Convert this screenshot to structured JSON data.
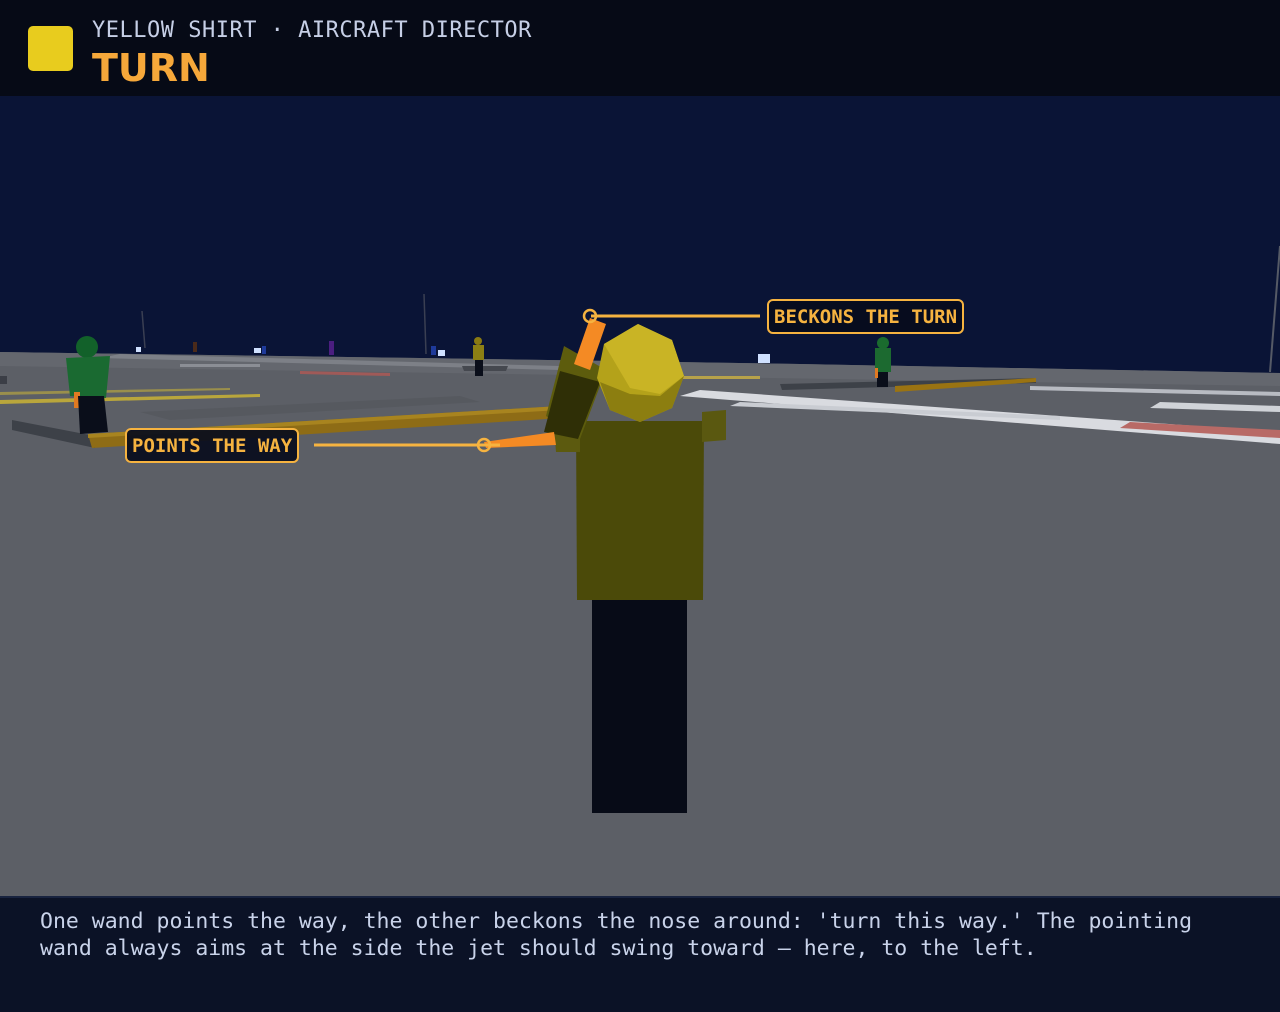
{
  "header": {
    "role_line": "YELLOW SHIRT · AIRCRAFT DIRECTOR",
    "signal_name": "TURN",
    "badge_color": "#e8cc1e",
    "icon": "yellow-shirt-color-swatch"
  },
  "callouts": {
    "beckons": "BECKONS THE TURN",
    "points": "POINTS THE WAY",
    "accent_color": "#f6b340"
  },
  "caption": {
    "text": "One wand points the way, the other beckons the nose around: 'turn this way.' The pointing wand always aims at the side the jet should swing toward — here, to the left."
  },
  "colors": {
    "sky": "#0a1436",
    "deck": "#5c5f66",
    "yellow_shirt": "#4b4a09",
    "wand": "#f48a24"
  }
}
